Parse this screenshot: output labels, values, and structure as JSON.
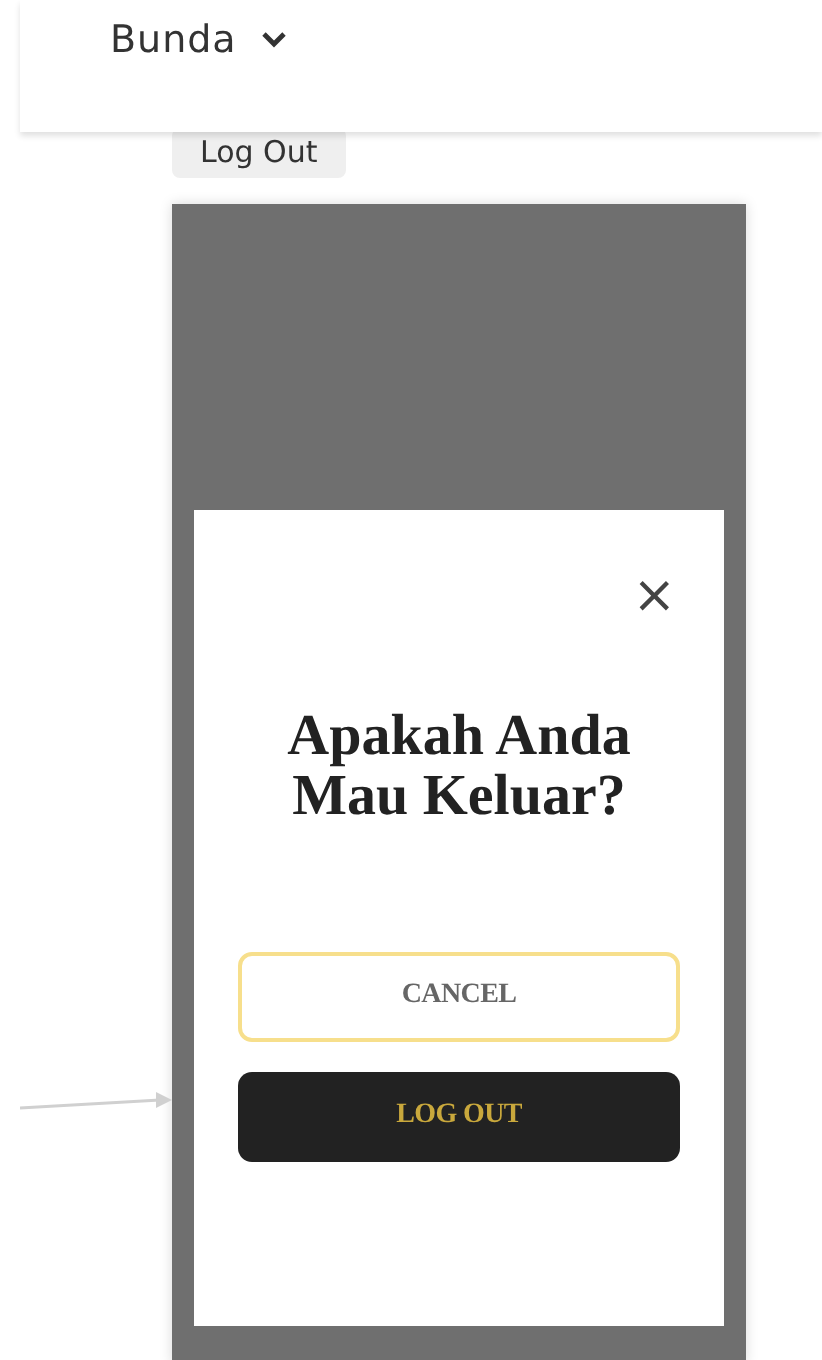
{
  "header": {
    "user_name": "Bunda"
  },
  "logout_chip": {
    "label": "Log Out"
  },
  "dialog": {
    "close": "×",
    "title": "Apakah Anda Mau Keluar?",
    "buttons": [
      {
        "label": "CANCEL",
        "kind": "outline"
      },
      {
        "label": "LOG OUT",
        "kind": "solid"
      }
    ]
  }
}
